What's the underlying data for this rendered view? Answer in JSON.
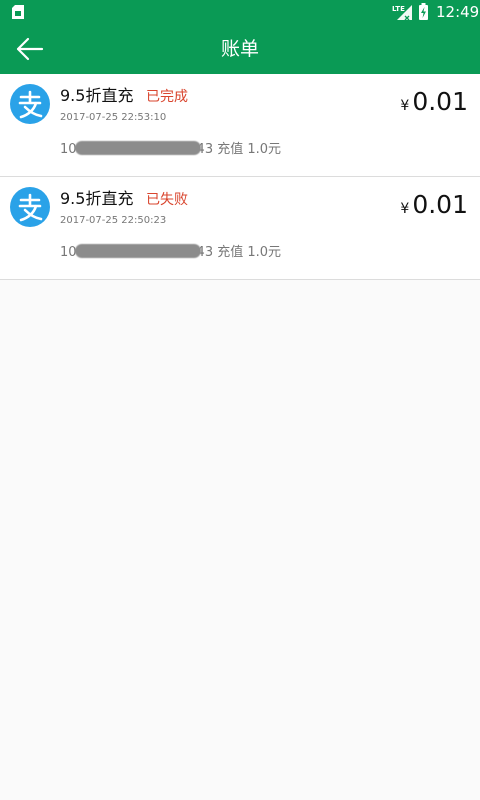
{
  "status_bar": {
    "time": "12:49",
    "network": "LTE",
    "icons": [
      "sim-card-icon",
      "lte-signal-icon",
      "battery-charging-icon"
    ]
  },
  "header": {
    "title": "账单",
    "back_icon": "arrow-left-icon",
    "bg_color": "#0a9a55"
  },
  "bills": [
    {
      "icon": "alipay-icon",
      "title": "9.5折直充",
      "status": "已完成",
      "date": "2017-07-25 22:53:10",
      "currency": "¥",
      "amount": "0.01",
      "desc_prefix": "10",
      "desc_suffix": "43 充值 1.0元"
    },
    {
      "icon": "alipay-icon",
      "title": "9.5折直充",
      "status": "已失败",
      "date": "2017-07-25 22:50:23",
      "currency": "¥",
      "amount": "0.01",
      "desc_prefix": "10",
      "desc_suffix": "43 充值 1.0元"
    }
  ],
  "colors": {
    "accent": "#0a9a55",
    "status": "#d9452e",
    "alipay": "#2aa2e8"
  }
}
